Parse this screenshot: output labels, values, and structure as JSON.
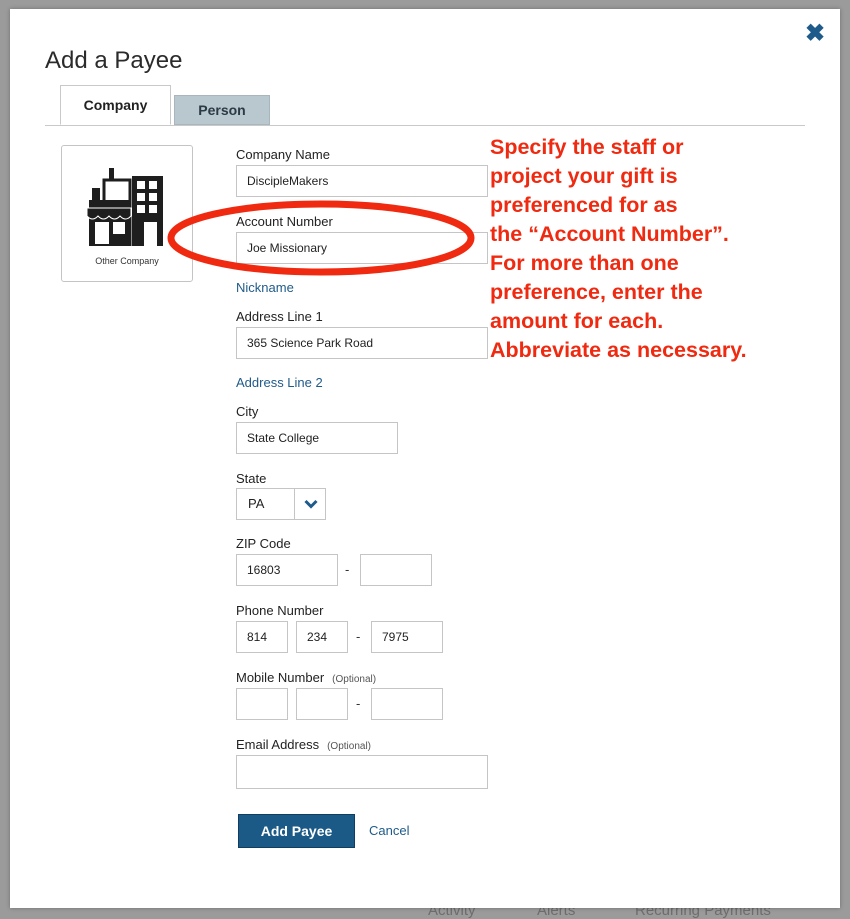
{
  "dialog": {
    "title": "Add a Payee",
    "close_icon": "close-icon",
    "tabs": [
      {
        "label": "Company",
        "active": true
      },
      {
        "label": "Person",
        "active": false
      }
    ],
    "payee_type": {
      "label": "Other Company",
      "icon": "store-building-icon"
    }
  },
  "form": {
    "company_name": {
      "label": "Company Name",
      "value": "DiscipleMakers"
    },
    "account_number": {
      "label": "Account Number",
      "value": "Joe Missionary"
    },
    "nickname_link": "Nickname",
    "address_line_1": {
      "label": "Address Line 1",
      "value": "365 Science Park Road"
    },
    "address_line_2_link": "Address Line 2",
    "city": {
      "label": "City",
      "value": "State College"
    },
    "state": {
      "label": "State",
      "value": "PA",
      "dropdown_icon": "chevron-down-icon"
    },
    "zip_code": {
      "label": "ZIP Code",
      "value": "16803",
      "ext_value": "",
      "separator": "-"
    },
    "phone_number": {
      "label": "Phone Number",
      "area": "814",
      "prefix": "234",
      "line": "7975",
      "separator": "-"
    },
    "mobile_number": {
      "label": "Mobile Number",
      "optional": "(Optional)",
      "area": "",
      "prefix": "",
      "line": "",
      "separator": "-"
    },
    "email_address": {
      "label": "Email Address",
      "optional": "(Optional)",
      "value": ""
    }
  },
  "actions": {
    "submit_label": "Add Payee",
    "cancel_label": "Cancel"
  },
  "annotation": {
    "color": "#ef2a10",
    "lines": [
      "Specify the staff or",
      "project your gift is",
      "preferenced for as",
      "the “Account Number”.",
      "For more than one",
      "preference, enter the",
      "amount for each.",
      "Abbreviate as necessary."
    ]
  },
  "background": {
    "footer_items": [
      "Activity",
      "Alerts",
      "Recurring Payments"
    ]
  },
  "colors": {
    "accent": "#1b5a86",
    "link": "#1f5b8a",
    "inactive_tab": "#b9c7cf",
    "annotation_red": "#ef2a10"
  }
}
